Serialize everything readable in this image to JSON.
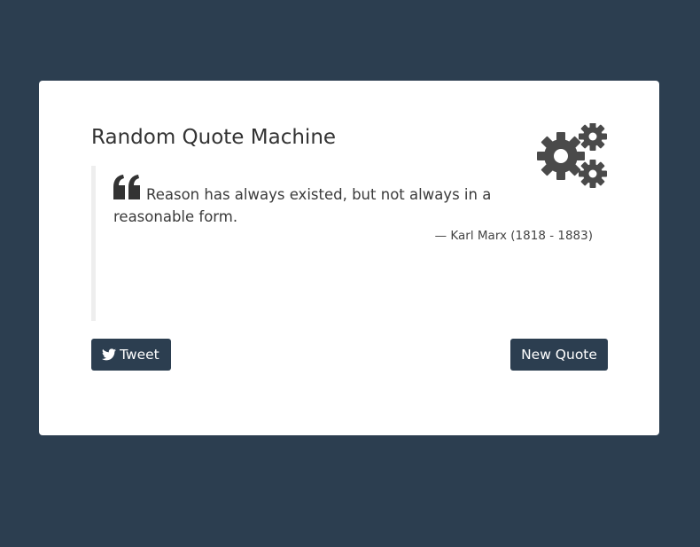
{
  "app": {
    "title": "Random Quote Machine"
  },
  "quote": {
    "text": "Reason has always existed, but not always in a reasonable form.",
    "author": "— Karl Marx (1818 - 1883)"
  },
  "actions": {
    "tweet_label": "Tweet",
    "new_quote_label": "New Quote"
  },
  "icons": {
    "header": "gears-icon",
    "quote": "quote-left-icon",
    "tweet": "twitter-icon"
  },
  "colors": {
    "background": "#2c3e50",
    "card": "#ffffff",
    "button": "#2c3e50",
    "icon": "#444444",
    "text": "#333333"
  }
}
